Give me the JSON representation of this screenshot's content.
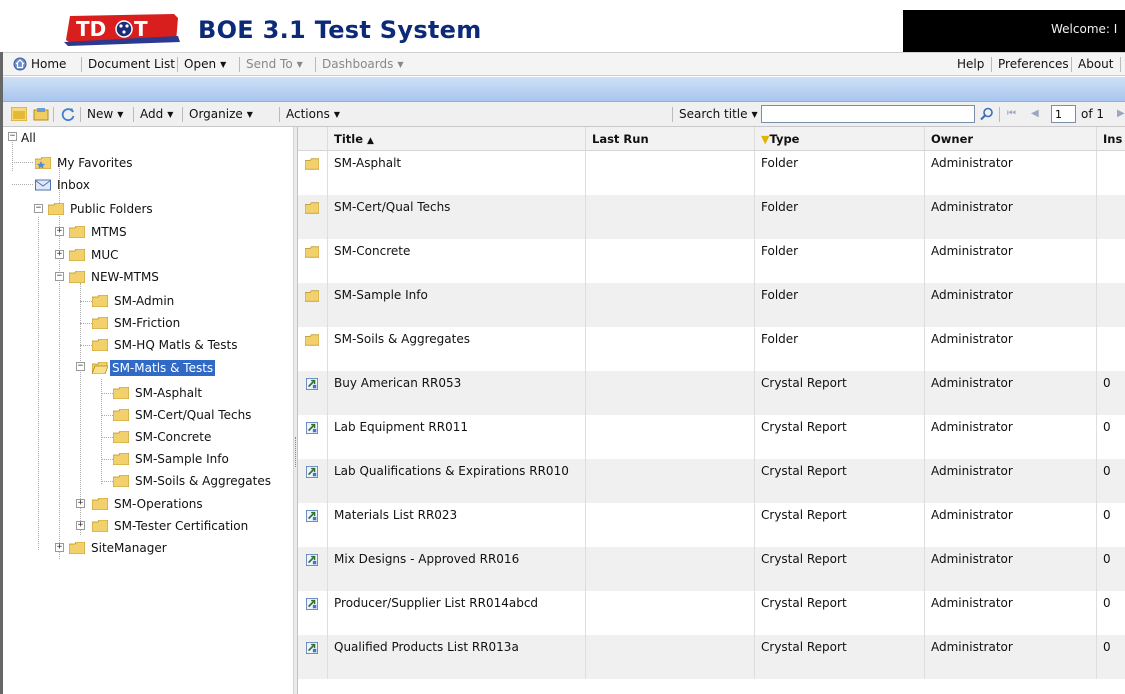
{
  "header": {
    "app_title": "BOE 3.1 Test System",
    "logo_text": "TDOT",
    "welcome": "Welcome: I"
  },
  "nav": {
    "home": "Home",
    "document_list": "Document List",
    "open": "Open",
    "send_to": "Send To",
    "dashboards": "Dashboards",
    "help": "Help",
    "preferences": "Preferences",
    "about": "About"
  },
  "toolbar": {
    "new": "New",
    "add": "Add",
    "organize": "Organize",
    "actions": "Actions",
    "search_label": "Search title",
    "search_value": "",
    "page_value": "1",
    "page_of": "of 1"
  },
  "tree": {
    "all": "All",
    "my_favorites": "My Favorites",
    "inbox": "Inbox",
    "public_folders": "Public Folders",
    "mtms": "MTMS",
    "muc": "MUC",
    "new_mtms": "NEW-MTMS",
    "sm_admin": "SM-Admin",
    "sm_friction": "SM-Friction",
    "sm_hq": "SM-HQ Matls & Tests",
    "sm_matls": "SM-Matls & Tests",
    "sm_asphalt": "SM-Asphalt",
    "sm_cert": "SM-Cert/Qual Techs",
    "sm_concrete": "SM-Concrete",
    "sm_sample": "SM-Sample Info",
    "sm_soils": "SM-Soils & Aggregates",
    "sm_operations": "SM-Operations",
    "sm_tester": "SM-Tester Certification",
    "sitemanager": "SiteManager"
  },
  "grid": {
    "columns": {
      "title": "Title",
      "last_run": "Last Run",
      "type": "Type",
      "owner": "Owner",
      "instances": "Ins"
    },
    "rows": [
      {
        "title": "SM-Asphalt",
        "last_run": "",
        "type": "Folder",
        "owner": "Administrator",
        "instances": ""
      },
      {
        "title": "SM-Cert/Qual Techs",
        "last_run": "",
        "type": "Folder",
        "owner": "Administrator",
        "instances": ""
      },
      {
        "title": "SM-Concrete",
        "last_run": "",
        "type": "Folder",
        "owner": "Administrator",
        "instances": ""
      },
      {
        "title": "SM-Sample Info",
        "last_run": "",
        "type": "Folder",
        "owner": "Administrator",
        "instances": ""
      },
      {
        "title": "SM-Soils & Aggregates",
        "last_run": "",
        "type": "Folder",
        "owner": "Administrator",
        "instances": ""
      },
      {
        "title": "Buy American  RR053",
        "last_run": "",
        "type": "Crystal Report",
        "owner": "Administrator",
        "instances": "0"
      },
      {
        "title": "Lab Equipment  RR011",
        "last_run": "",
        "type": "Crystal Report",
        "owner": "Administrator",
        "instances": "0"
      },
      {
        "title": "Lab Qualifications & Expirations  RR010",
        "last_run": "",
        "type": "Crystal Report",
        "owner": "Administrator",
        "instances": "0"
      },
      {
        "title": "Materials List  RR023",
        "last_run": "",
        "type": "Crystal Report",
        "owner": "Administrator",
        "instances": "0"
      },
      {
        "title": "Mix Designs - Approved  RR016",
        "last_run": "",
        "type": "Crystal Report",
        "owner": "Administrator",
        "instances": "0"
      },
      {
        "title": "Producer/Supplier List  RR014abcd",
        "last_run": "",
        "type": "Crystal Report",
        "owner": "Administrator",
        "instances": "0"
      },
      {
        "title": "Qualified Products List  RR013a",
        "last_run": "",
        "type": "Crystal Report",
        "owner": "Administrator",
        "instances": "0"
      }
    ]
  }
}
